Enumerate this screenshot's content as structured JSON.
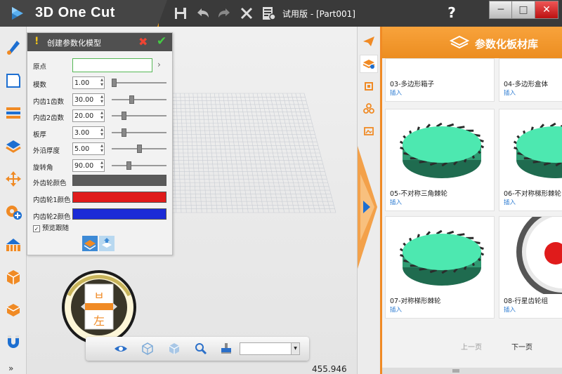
{
  "app": {
    "title": "3D One Cut",
    "document_title": "试用版 - [Part001]"
  },
  "toolbar": {
    "save_icon": "save-icon",
    "undo_icon": "undo-icon",
    "redo_icon": "redo-icon",
    "delete_icon": "close-icon",
    "settings_icon": "properties-icon",
    "help": "?"
  },
  "window": {
    "minimize": "─",
    "maximize": "□",
    "close": "✕"
  },
  "left_toolbar": {
    "more": "»"
  },
  "param_panel": {
    "title": "创建参数化模型",
    "origin_label": "原点",
    "rows": [
      {
        "label": "模数",
        "value": "1.00",
        "slider": 0.0
      },
      {
        "label": "内齿1齿数",
        "value": "30.00",
        "slider": 0.35
      },
      {
        "label": "内齿2齿数",
        "value": "20.00",
        "slider": 0.2
      },
      {
        "label": "板厚",
        "value": "3.00",
        "slider": 0.2
      },
      {
        "label": "外沿厚度",
        "value": "5.00",
        "slider": 0.5
      },
      {
        "label": "旋转角",
        "value": "90.00",
        "slider": 0.3
      }
    ],
    "colors": [
      {
        "label": "外齿轮颜色",
        "color": "#5a5a5a"
      },
      {
        "label": "内齿轮1颜色",
        "color": "#e01b1b"
      },
      {
        "label": "内齿轮2颜色",
        "color": "#1b2bd6"
      }
    ],
    "preview_label": "预览跟随",
    "preview_checked": "✓"
  },
  "viewcube": {
    "top_face": "ㅂ",
    "front_face": "左"
  },
  "status": {
    "measure": "455.946 mm"
  },
  "library": {
    "title": "参数化板材库",
    "cards": [
      {
        "name": "03-多边形箱子",
        "insert": "插入"
      },
      {
        "name": "04-多边形盒体",
        "insert": "插入"
      },
      {
        "name": "05-不对称三角棘轮",
        "insert": "插入"
      },
      {
        "name": "06-不对称梯形棘轮",
        "insert": "插入"
      },
      {
        "name": "07-对称梯形棘轮",
        "insert": "插入"
      },
      {
        "name": "08-行星齿轮组",
        "insert": "插入"
      }
    ],
    "prev_page": "上一页",
    "next_page": "下一页"
  },
  "colors": {
    "accent": "#f39c12",
    "gear": "#4de8b0",
    "link": "#2a7ad1"
  }
}
